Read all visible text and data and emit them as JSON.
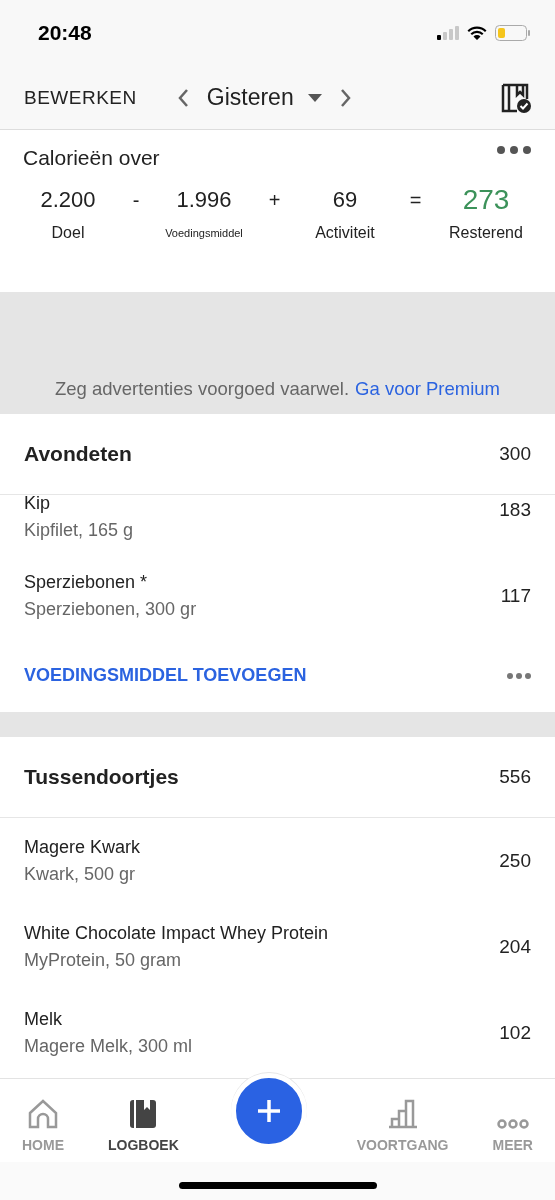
{
  "status_bar": {
    "time": "20:48"
  },
  "header": {
    "edit": "BEWERKEN",
    "date": "Gisteren"
  },
  "summary": {
    "title": "Calorieën over",
    "terms": [
      {
        "value": "2.200",
        "label": "Doel",
        "kind": "normal"
      },
      {
        "op": "-"
      },
      {
        "value": "1.996",
        "label": "Voedingsmiddel",
        "kind": "small"
      },
      {
        "op": "+"
      },
      {
        "value": "69",
        "label": "Activiteit",
        "kind": "normal"
      },
      {
        "op": "="
      },
      {
        "value": "273",
        "label": "Resterend",
        "kind": "result"
      }
    ]
  },
  "ad": {
    "text": "Zeg advertenties voorgoed vaarwel.",
    "link": "Ga voor Premium"
  },
  "meals": [
    {
      "name": "Avondeten",
      "total": "300",
      "items": [
        {
          "name": "Kip",
          "detail": "Kipfilet, 165 g",
          "calories": "183"
        },
        {
          "name": "Sperziebonen *",
          "detail": "Sperziebonen, 300 gr",
          "calories": "117"
        }
      ],
      "add": "VOEDINGSMIDDEL TOEVOEGEN"
    },
    {
      "name": "Tussendoortjes",
      "total": "556",
      "items": [
        {
          "name": "Magere Kwark",
          "detail": "Kwark, 500 gr",
          "calories": "250"
        },
        {
          "name": "White Chocolate Impact Whey Protein",
          "detail": "MyProtein, 50 gram",
          "calories": "204"
        },
        {
          "name": "Melk",
          "detail": "Magere Melk, 300 ml",
          "calories": "102"
        }
      ]
    }
  ],
  "tab_bar": [
    {
      "label": "HOME",
      "kind": "home",
      "selected": false
    },
    {
      "label": "LOGBOEK",
      "kind": "log",
      "selected": true
    },
    {
      "kind": "add",
      "selected": false
    },
    {
      "label": "VOORTGANG",
      "kind": "progress",
      "selected": false
    },
    {
      "label": "MEER",
      "kind": "more",
      "selected": false
    }
  ]
}
